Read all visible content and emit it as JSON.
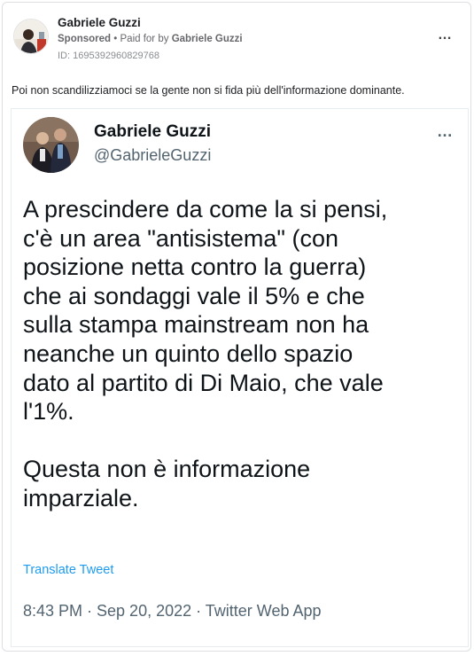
{
  "ad": {
    "advertiser_name": "Gabriele Guzzi",
    "sponsored_label": "Sponsored",
    "separator": "•",
    "paid_for_prefix": "Paid for by",
    "paid_for_name": "Gabriele Guzzi",
    "id_text": "ID: 1695392960829768",
    "more_icon": "…",
    "caption": "Poi non scandilizziamoci se la gente non si fida più dell'informazione dominante."
  },
  "tweet": {
    "name": "Gabriele Guzzi",
    "handle": "@GabrieleGuzzi",
    "more_icon": "…",
    "body_lines": [
      "A prescindere da come la si pensi,",
      "c'è un area \"antisistema\" (con",
      "posizione netta contro la guerra)",
      "che ai sondaggi vale il 5% e che",
      "sulla stampa mainstream non ha",
      "neanche un quinto dello spazio",
      "dato al partito di Di Maio, che vale",
      "l'1%."
    ],
    "body_lines_2": [
      "Questa non è informazione",
      "imparziale."
    ],
    "translate_label": "Translate Tweet",
    "meta": "8:43 PM · Sep 20, 2022 · Twitter Web App"
  },
  "colors": {
    "twitter_blue": "#1d9bf0",
    "secondary_text": "#536471",
    "border": "#dddfe2"
  }
}
